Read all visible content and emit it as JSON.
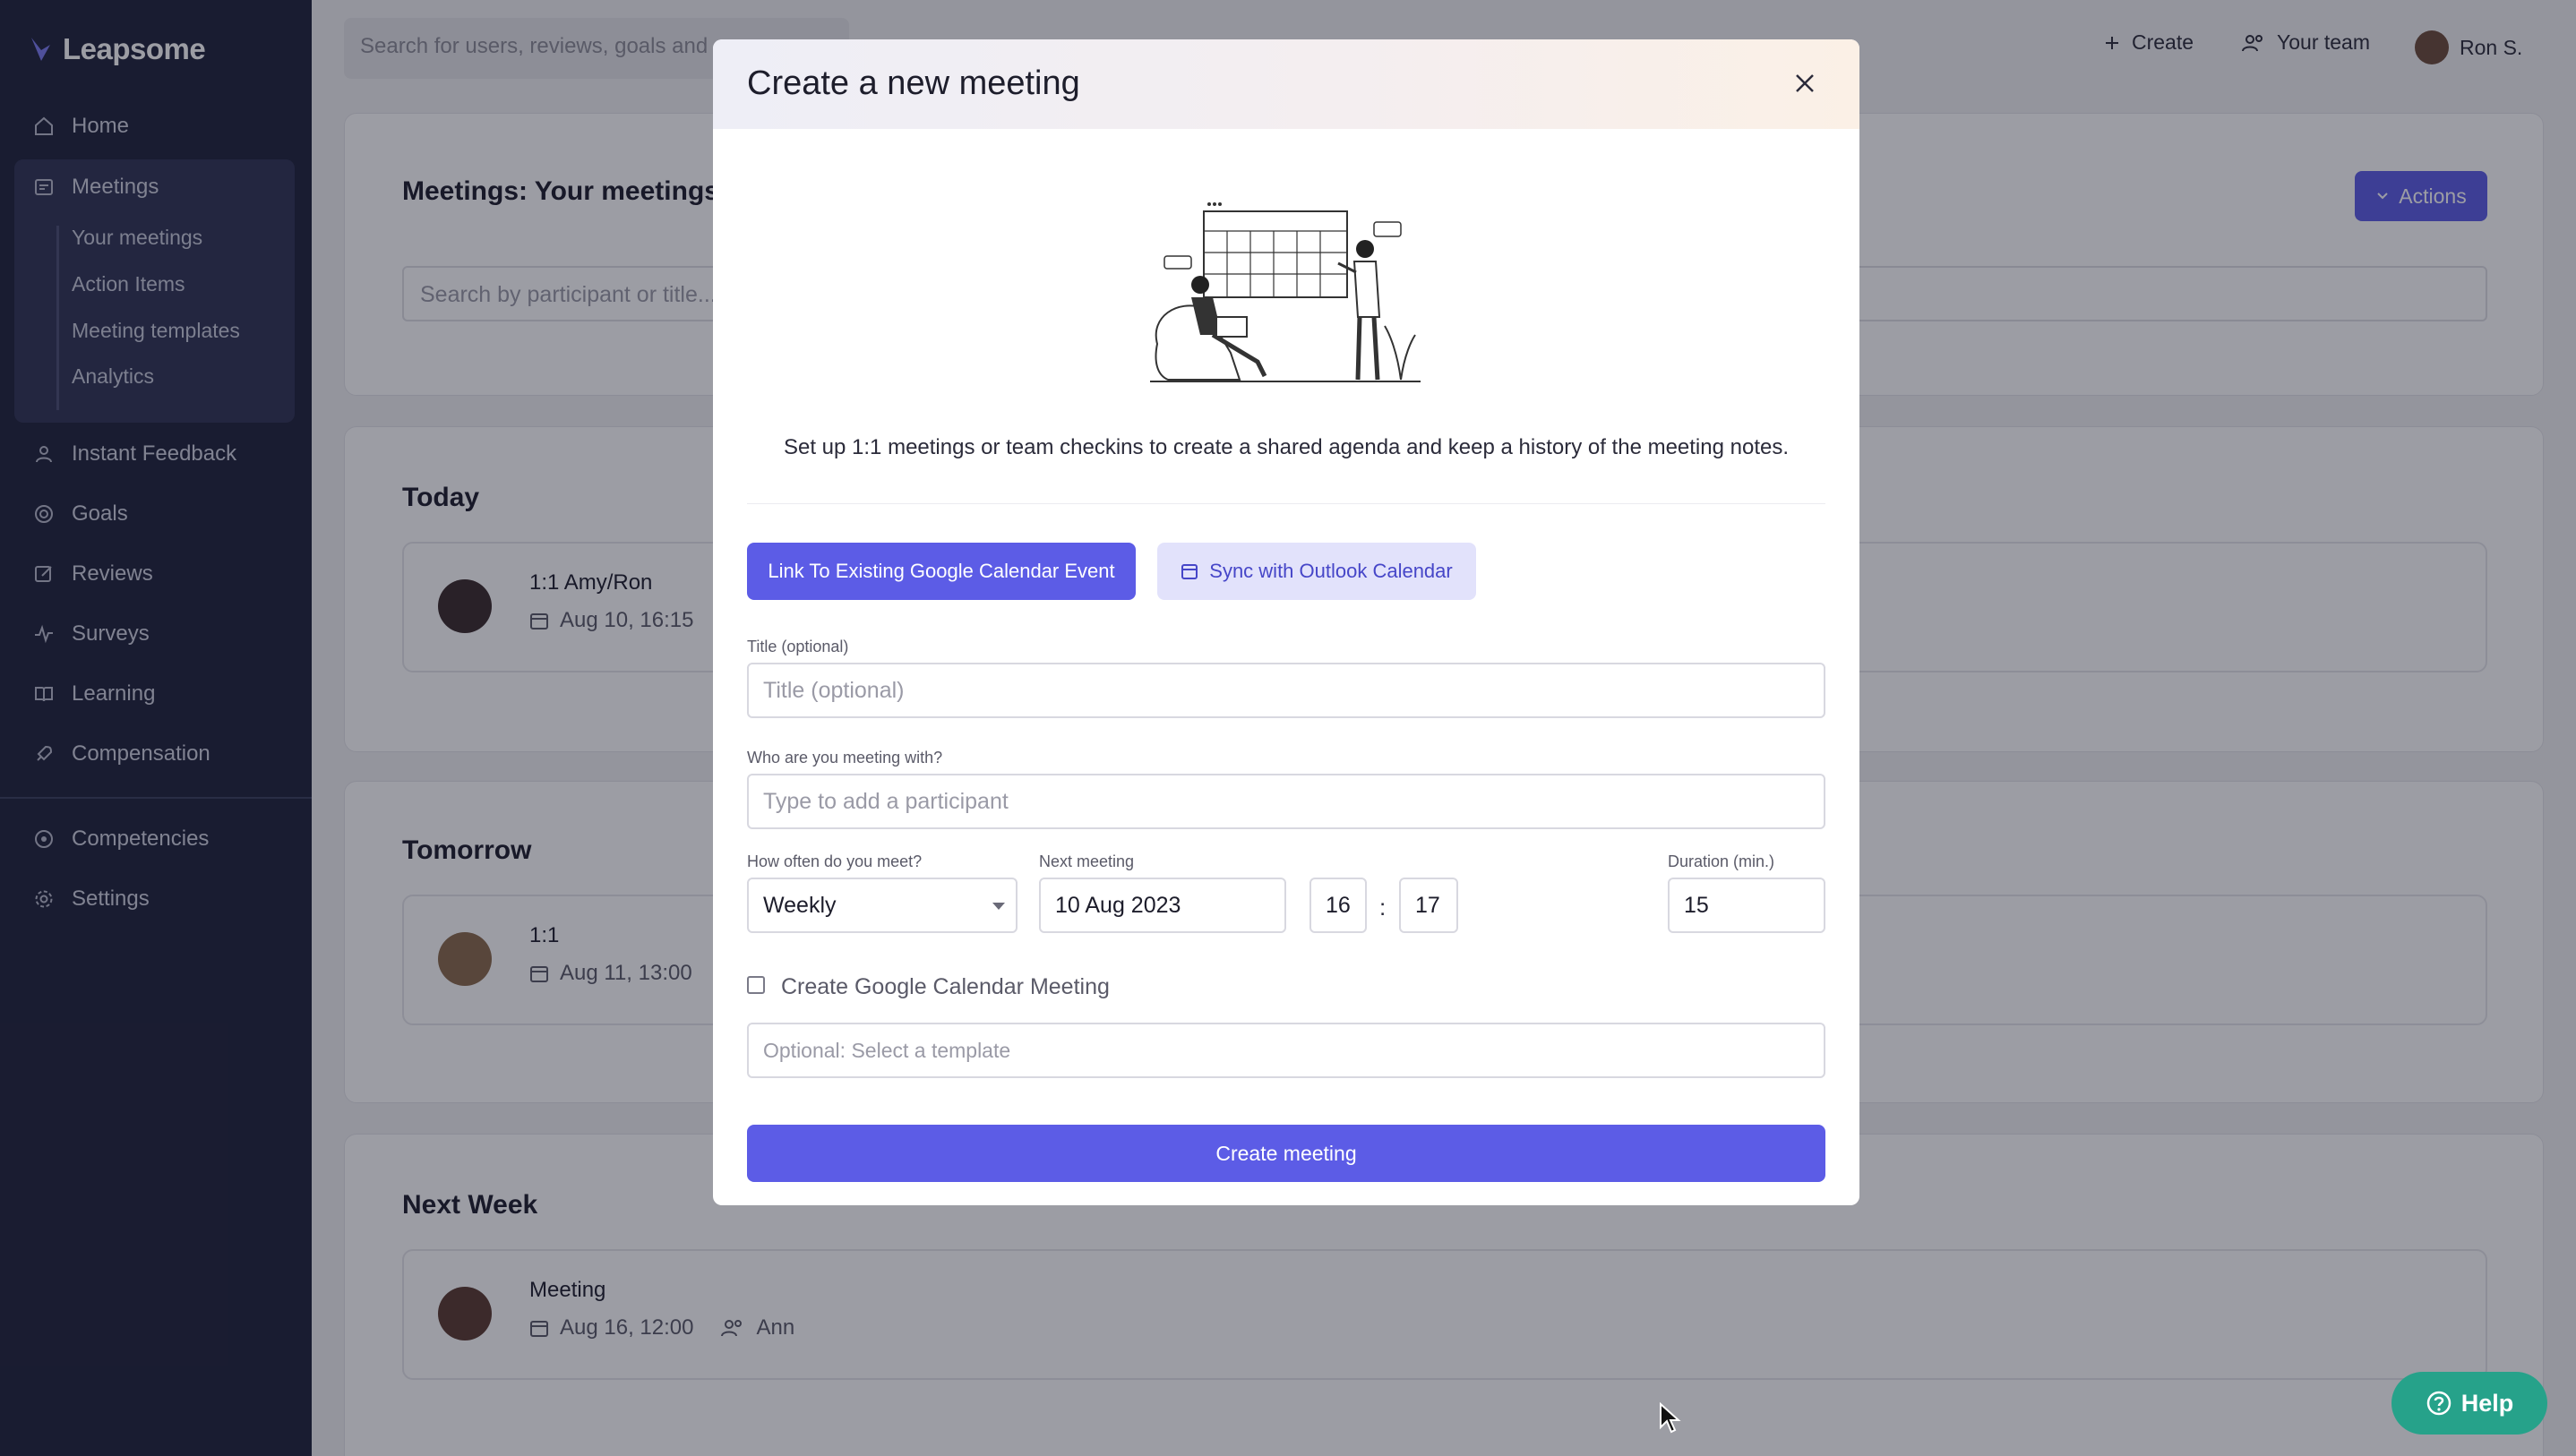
{
  "sidebar": {
    "logo": "Leapsome",
    "items": {
      "home": "Home",
      "meetings": "Meetings",
      "instant_feedback": "Instant Feedback",
      "goals": "Goals",
      "reviews": "Reviews",
      "surveys": "Surveys",
      "learning": "Learning",
      "compensation": "Compensation",
      "competencies": "Competencies",
      "settings": "Settings"
    },
    "meetings_sub": {
      "your_meetings": "Your meetings",
      "action_items": "Action Items",
      "meeting_templates": "Meeting templates",
      "analytics": "Analytics"
    }
  },
  "topbar": {
    "search_placeholder": "Search for users, reviews, goals and",
    "create": "Create",
    "your_team": "Your team",
    "user": "Ron S."
  },
  "page": {
    "title": "Meetings: Your meetings",
    "actions": "Actions",
    "search_placeholder": "Search by participant or title..."
  },
  "sections": {
    "today": {
      "heading": "Today",
      "meeting": {
        "title": "1:1 Amy/Ron",
        "date": "Aug 10, 16:15"
      }
    },
    "tomorrow": {
      "heading": "Tomorrow",
      "meeting": {
        "title": "1:1",
        "date": "Aug 11, 13:00"
      }
    },
    "next_week": {
      "heading": "Next Week",
      "meeting": {
        "title": "Meeting",
        "date": "Aug 16, 12:00",
        "participant": "Ann"
      }
    }
  },
  "modal": {
    "title": "Create a new meeting",
    "intro": "Set up 1:1 meetings or team checkins to create a shared agenda and keep a history of the meeting notes.",
    "link_google": "Link To Existing Google Calendar Event",
    "sync_outlook": "Sync with Outlook Calendar",
    "title_label": "Title (optional)",
    "title_placeholder": "Title (optional)",
    "participant_label": "Who are you meeting with?",
    "participant_placeholder": "Type to add a participant",
    "frequency_label": "How often do you meet?",
    "frequency_value": "Weekly",
    "next_meeting_label": "Next meeting",
    "next_meeting_date": "10 Aug 2023",
    "hour": "16",
    "time_separator": ":",
    "minute": "17",
    "duration_label": "Duration (min.)",
    "duration_value": "15",
    "google_checkbox_label": "Create Google Calendar Meeting",
    "google_checkbox_checked": false,
    "template_placeholder": "Optional: Select a template",
    "create_button": "Create meeting"
  },
  "help": {
    "label": "Help"
  },
  "colors": {
    "sidebar_bg": "#1e2139",
    "accent": "#5c5ce6",
    "help_green": "#26a28a"
  }
}
